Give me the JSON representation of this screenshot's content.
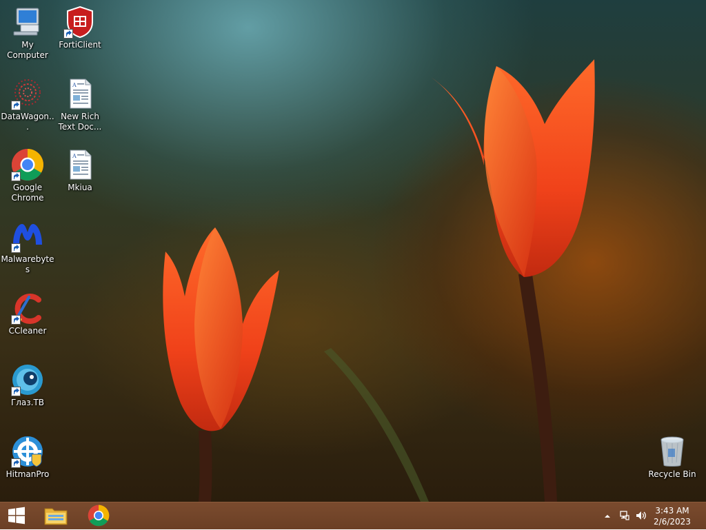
{
  "desktop": {
    "icons": [
      {
        "label": "My Computer"
      },
      {
        "label": "FortiClient"
      },
      {
        "label": "DataWagon..."
      },
      {
        "label": "New Rich Text Doc..."
      },
      {
        "label": "Google Chrome"
      },
      {
        "label": "Mkiua"
      },
      {
        "label": "Malwarebytes"
      },
      {
        "label": "CCleaner"
      },
      {
        "label": "Глаз.ТВ"
      },
      {
        "label": "HitmanPro"
      },
      {
        "label": "Recycle Bin"
      }
    ]
  },
  "taskbar": {
    "start_icon": "windows-logo-icon",
    "pinned": [
      "file-explorer-icon",
      "chrome-icon"
    ],
    "tray_icons": [
      "show-hidden-icons-icon",
      "network-icon",
      "volume-icon"
    ],
    "time": "3:43 AM",
    "date": "2/6/2023"
  },
  "colors": {
    "taskbar": "#6e4128",
    "accent": "#ff5a1f"
  }
}
